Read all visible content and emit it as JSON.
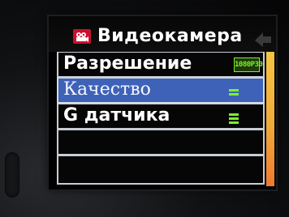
{
  "title": {
    "icon": "camcorder-icon",
    "text": "Видеокамера"
  },
  "menu": {
    "items": [
      {
        "label": "Разрешение",
        "value_badge": "1080P30",
        "value_icon": "resolution-badge-icon",
        "selected": false
      },
      {
        "label": "Качество",
        "value_icon": "quality-bars-icon",
        "value_level": "2 of 3",
        "selected": true
      },
      {
        "label": "G датчика",
        "value_icon": "sensitivity-bars-icon",
        "value_level": "3 of 3",
        "selected": false
      },
      {
        "label": "",
        "selected": false
      },
      {
        "label": "",
        "selected": false
      }
    ]
  },
  "scrollbar": {
    "position_fraction": 0.0,
    "visible_fraction": 1.0
  },
  "colors": {
    "accent_selected_row": "#3e62b8",
    "value_green": "#7cf02a",
    "scrollbar": "#f5c542",
    "icon_red": "#c8102e"
  }
}
